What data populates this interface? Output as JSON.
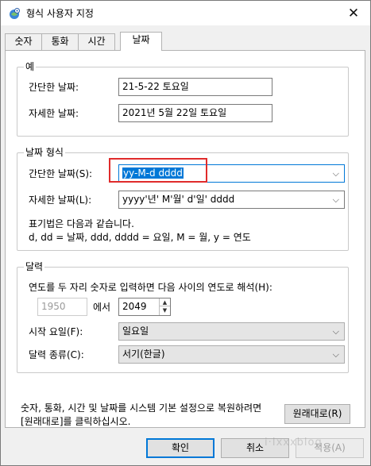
{
  "window": {
    "title": "형식 사용자 지정",
    "close_glyph": "✕"
  },
  "tabs": [
    {
      "label": "숫자"
    },
    {
      "label": "통화"
    },
    {
      "label": "시간"
    },
    {
      "label": "날짜"
    }
  ],
  "example": {
    "group_label": "예",
    "short_label": "간단한 날짜:",
    "short_value": "21-5-22 토요일",
    "long_label": "자세한 날짜:",
    "long_value": "2021년 5월 22일 토요일"
  },
  "date_format": {
    "group_label": "날짜 형식",
    "short_label": "간단한 날짜(S):",
    "short_value": "yy-M-d dddd",
    "long_label": "자세한 날짜(L):",
    "long_value": "yyyy'년' M'월' d'일' dddd",
    "notation_line1": "표기법은 다음과 같습니다.",
    "notation_line2": "d, dd = 날짜,  ddd, dddd = 요일,  M = 월,  y = 연도"
  },
  "calendar": {
    "group_label": "달력",
    "two_digit_label": "연도를 두 자리 숫자로 입력하면 다음 사이의 연도로 해석(H):",
    "year_from": "1950",
    "year_sep": "에서",
    "year_to": "2049",
    "first_day_label": "시작 요일(F):",
    "first_day_value": "일요일",
    "calendar_type_label": "달력 종류(C):",
    "calendar_type_value": "서기(한글)"
  },
  "reset": {
    "text_line1": "숫자, 통화, 시간 및 날짜를 시스템 기본 설정으로 복원하려면",
    "text_line2": "[원래대로]를 클릭하십시오.",
    "button_label": "원래대로(R)"
  },
  "footer": {
    "ok_label": "확인",
    "cancel_label": "취소",
    "apply_label": "적용(A)",
    "watermark": "i·Ixxxblog"
  },
  "colors": {
    "accent": "#0078d7",
    "highlight_box": "#e02b2b"
  }
}
